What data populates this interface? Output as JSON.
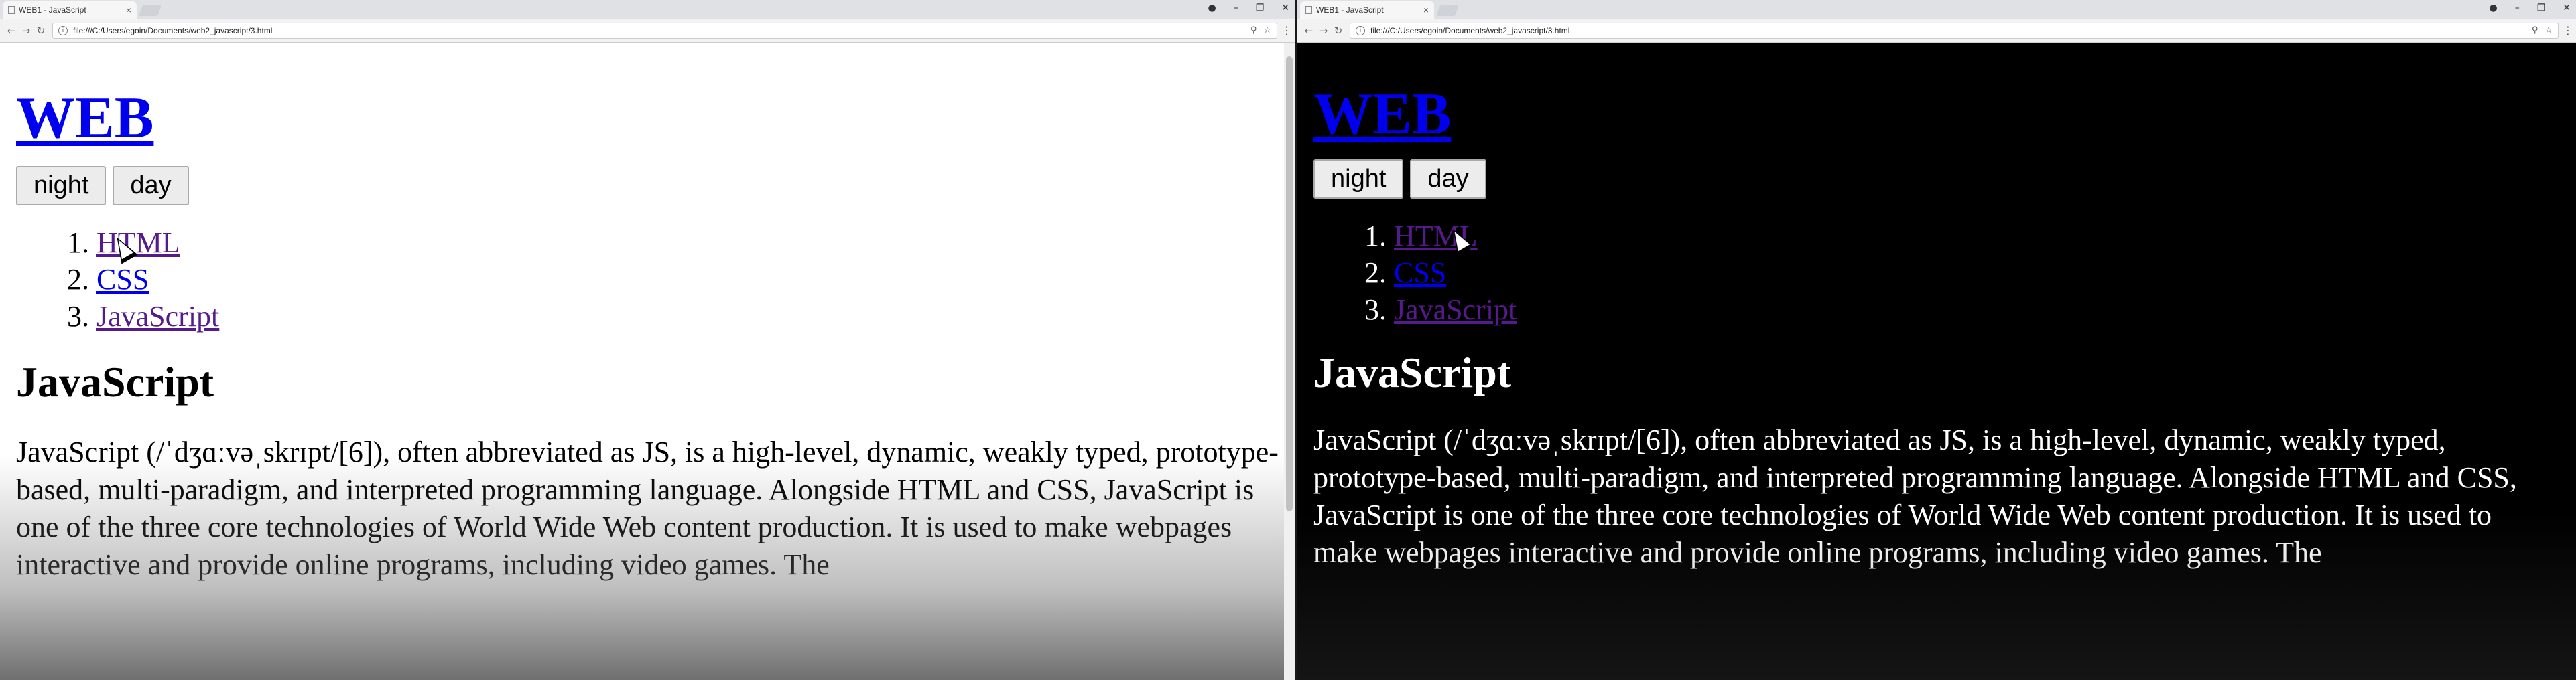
{
  "left": {
    "tab_title": "WEB1 - JavaScript",
    "url": "file:///C:/Users/egoin/Documents/web2_javascript/3.html",
    "site_title": "WEB",
    "buttons": {
      "night": "night",
      "day": "day"
    },
    "menu": [
      "HTML",
      "CSS",
      "JavaScript"
    ],
    "article_title": "JavaScript",
    "body_text": "JavaScript (/ˈdʒɑːvəˌskrɪpt/[6]), often abbreviated as JS, is a high-level, dynamic, weakly typed, prototype-based, multi-paradigm, and interpreted programming language. Alongside HTML and CSS, JavaScript is one of the three core technologies of World Wide Web content production. It is used to make webpages interactive and provide online programs, including video games. The"
  },
  "right": {
    "tab_title": "WEB1 - JavaScript",
    "url": "file:///C:/Users/egoin/Documents/web2_javascript/3.html",
    "site_title": "WEB",
    "buttons": {
      "night": "night",
      "day": "day"
    },
    "menu": [
      "HTML",
      "CSS",
      "JavaScript"
    ],
    "article_title": "JavaScript",
    "body_text": "JavaScript (/ˈdʒɑːvəˌskrɪpt/[6]), often abbreviated as JS, is a high-level, dynamic, weakly typed, prototype-based, multi-paradigm, and interpreted programming language. Alongside HTML and CSS, JavaScript is one of the three core technologies of World Wide Web content production. It is used to make webpages interactive and provide online programs, including video games. The"
  },
  "icons": {
    "back": "←",
    "forward": "→",
    "reload": "↻",
    "info": "i",
    "zoom": "⚲",
    "star": "☆",
    "menu": "⋮",
    "minimize": "–",
    "restore": "❐",
    "close": "✕",
    "tab_close": "×",
    "account": "●"
  },
  "colors": {
    "link_unvisited": "#0000ee",
    "link_visited": "#551a8b",
    "day_bg": "#ffffff",
    "night_bg": "#000000"
  }
}
